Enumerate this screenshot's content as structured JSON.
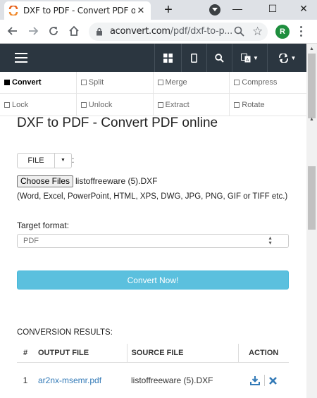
{
  "browser": {
    "tab_title": "DXF to PDF - Convert PDF online",
    "url_host": "aconvert.com",
    "url_path": "/pdf/dxf-to-p...",
    "profile_initial": "R"
  },
  "menu": {
    "row1": [
      "Convert",
      "Split",
      "Merge",
      "Compress"
    ],
    "row2": [
      "Lock",
      "Unlock",
      "Extract",
      "Rotate"
    ]
  },
  "main": {
    "title": "DXF to PDF - Convert PDF online",
    "file_button": "FILE",
    "file_colon": ":",
    "choose_files": "Choose Files",
    "chosen_file": "listoffreeware (5).DXF",
    "formats_note": "(Word, Excel, PowerPoint, HTML, XPS, DWG, JPG, PNG, GIF or TIFF etc.)",
    "target_format_label": "Target format:",
    "target_format_value": "PDF",
    "convert_button": "Convert Now!"
  },
  "results": {
    "label": "CONVERSION RESULTS:",
    "headers": [
      "#",
      "OUTPUT FILE",
      "SOURCE FILE",
      "ACTION"
    ],
    "rows": [
      {
        "no": "1",
        "output": "ar2nx-msemr.pdf",
        "source": "listoffreeware (5).DXF"
      }
    ]
  },
  "colors": {
    "nav_bg": "#2b3640",
    "convert_btn": "#5bc0de",
    "link": "#337ab7"
  }
}
